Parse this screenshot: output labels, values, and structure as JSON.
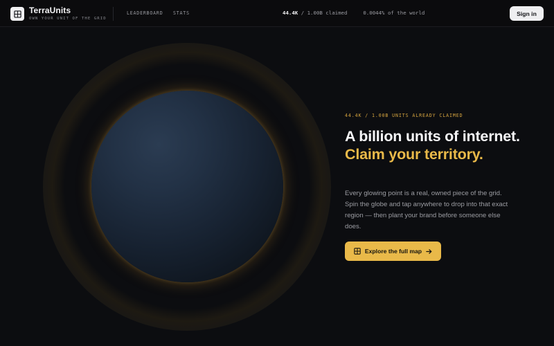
{
  "header": {
    "brand_name": "TerraUnits",
    "brand_tagline": "OWN YOUR UNIT OF THE GRID",
    "nav": [
      {
        "label": "LEADERBOARD"
      },
      {
        "label": "STATS"
      }
    ],
    "stats": {
      "claimed_count": "44.4K",
      "claimed_suffix": "/ 1.00B claimed",
      "world_share": "0.0044% of the world"
    },
    "signin_label": "Sign in"
  },
  "hero": {
    "eyebrow": "44.4K / 1.00B UNITS ALREADY CLAIMED",
    "headline_plain": "A billion units of internet.",
    "headline_accent": "Claim your territory.",
    "description": "Every glowing point is a real, owned piece of the grid. Spin the globe and tap anywhere to drop into that exact region — then plant your brand before someone else does.",
    "cta_label": "Explore the full map"
  },
  "colors": {
    "accent": "#e9b949",
    "background": "#0c0d10",
    "globe": "#1c2838"
  },
  "icons": {
    "logo": "grid-icon",
    "cta": "grid-icon",
    "cta_arrow": "arrow-right-icon"
  }
}
